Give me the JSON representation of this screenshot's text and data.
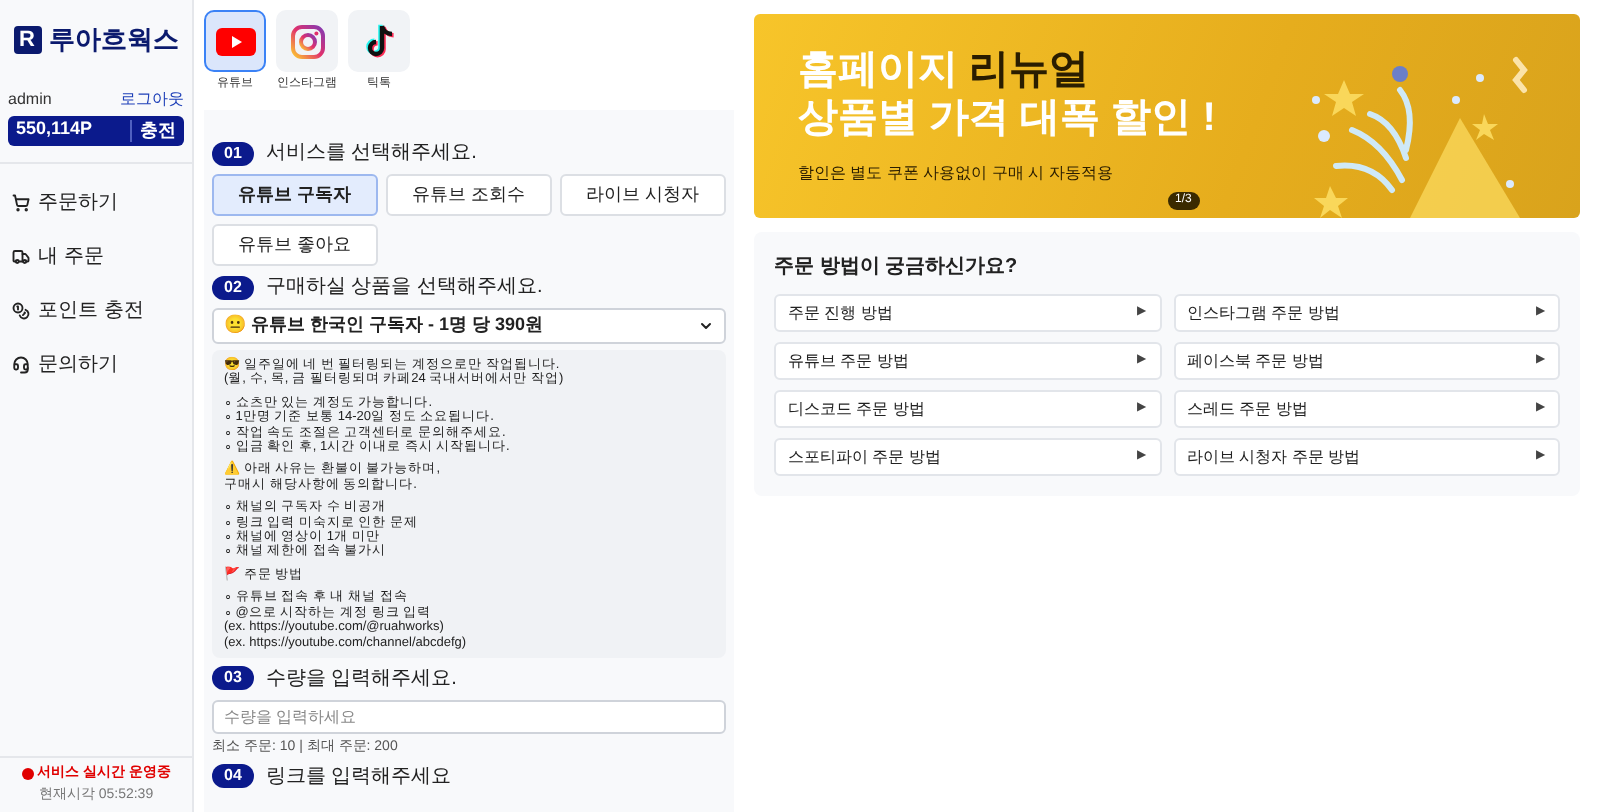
{
  "sidebar": {
    "logo_mark": "R",
    "logo_text": "루아흐웍스",
    "user": "admin",
    "logout": "로그아웃",
    "points": "550,114P",
    "charge": "충전",
    "menu": [
      {
        "kind": "cart",
        "label": "주문하기"
      },
      {
        "kind": "truck",
        "label": "내 주문"
      },
      {
        "kind": "coins",
        "label": "포인트 충전"
      },
      {
        "kind": "headset",
        "label": "문의하기"
      }
    ],
    "status": "서비스 실시간 운영중",
    "clock": "현재시각 05:52:39"
  },
  "platforms": [
    {
      "kind": "youtube",
      "label": "유튜브",
      "selected": true
    },
    {
      "kind": "instagram",
      "label": "인스타그램",
      "selected": false
    },
    {
      "kind": "tiktok",
      "label": "틱톡",
      "selected": false
    }
  ],
  "steps": {
    "s1": {
      "num": "01",
      "title": "서비스를 선택해주세요.",
      "options": [
        {
          "label": "유튜브 구독자",
          "selected": true
        },
        {
          "label": "유튜브 조회수",
          "selected": false
        },
        {
          "label": "라이브 시청자",
          "selected": false
        },
        {
          "label": "유튜브 좋아요",
          "selected": false
        }
      ]
    },
    "s2": {
      "num": "02",
      "title": "구매하실 상품을 선택해주세요.",
      "value": "😐 유튜브 한국인 구독자 - 1명 당 390원"
    },
    "info": [
      [
        "😎 일주일에 네 번 필터링되는 계정으로만 작업됩니다.",
        "(월, 수, 목, 금 필터링되며 카페24 국내서버에서만 작업)"
      ],
      [
        "∘ 쇼츠만 있는 계정도 가능합니다.",
        "∘ 1만명 기준 보통 14-20일 정도 소요됩니다.",
        "∘ 작업 속도 조절은 고객센터로 문의해주세요.",
        "∘ 입금 확인 후, 1시간 이내로 즉시 시작됩니다."
      ],
      [
        "⚠️ 아래 사유는 환불이 불가능하며,",
        "구매시 해당사항에 동의합니다."
      ],
      [
        "∘ 채널의 구독자 수 비공개",
        "∘ 링크 입력 미숙지로 인한 문제",
        "∘ 채널에 영상이 1개 미만",
        "∘ 채널 제한에 접속 불가시"
      ],
      [
        "🚩 주문 방법"
      ],
      [
        "∘ 유튜브 접속 후 내 채널 접속",
        "∘ @으로 시작하는 계정 링크 입력",
        "(ex. https://youtube.com/@ruahworks)",
        "(ex. https://youtube.com/channel/abcdefg)"
      ]
    ],
    "s3": {
      "num": "03",
      "title": "수량을 입력해주세요.",
      "placeholder": "수량을 입력하세요",
      "hint": "최소 주문: 10 | 최대 주문: 200"
    },
    "s4": {
      "num": "04",
      "title": "링크를 입력해주세요"
    }
  },
  "banner": {
    "line1": "홈페이지 **리뉴얼**",
    "line2": "상품별 가격 대폭 할인 !",
    "sub": "할인은 별도 쿠폰 사용없이 구매 시 자동적용",
    "pager": "1/3"
  },
  "faq": {
    "title": "주문 방법이 궁금하신가요?",
    "items": [
      {
        "label": "주문 진행 방법",
        "arrow": "▶"
      },
      {
        "label": "인스타그램 주문 방법",
        "arrow": "▶"
      },
      {
        "label": "유튜브 주문 방법",
        "arrow": "▶"
      },
      {
        "label": "페이스북 주문 방법",
        "arrow": "▶"
      },
      {
        "label": "디스코드 주문 방법",
        "arrow": "▶"
      },
      {
        "label": "스레드 주문 방법",
        "arrow": "▶"
      },
      {
        "label": "스포티파이 주문 방법",
        "arrow": "▶"
      },
      {
        "label": "라이브 시청자 주문 방법",
        "arrow": "▶"
      }
    ]
  }
}
